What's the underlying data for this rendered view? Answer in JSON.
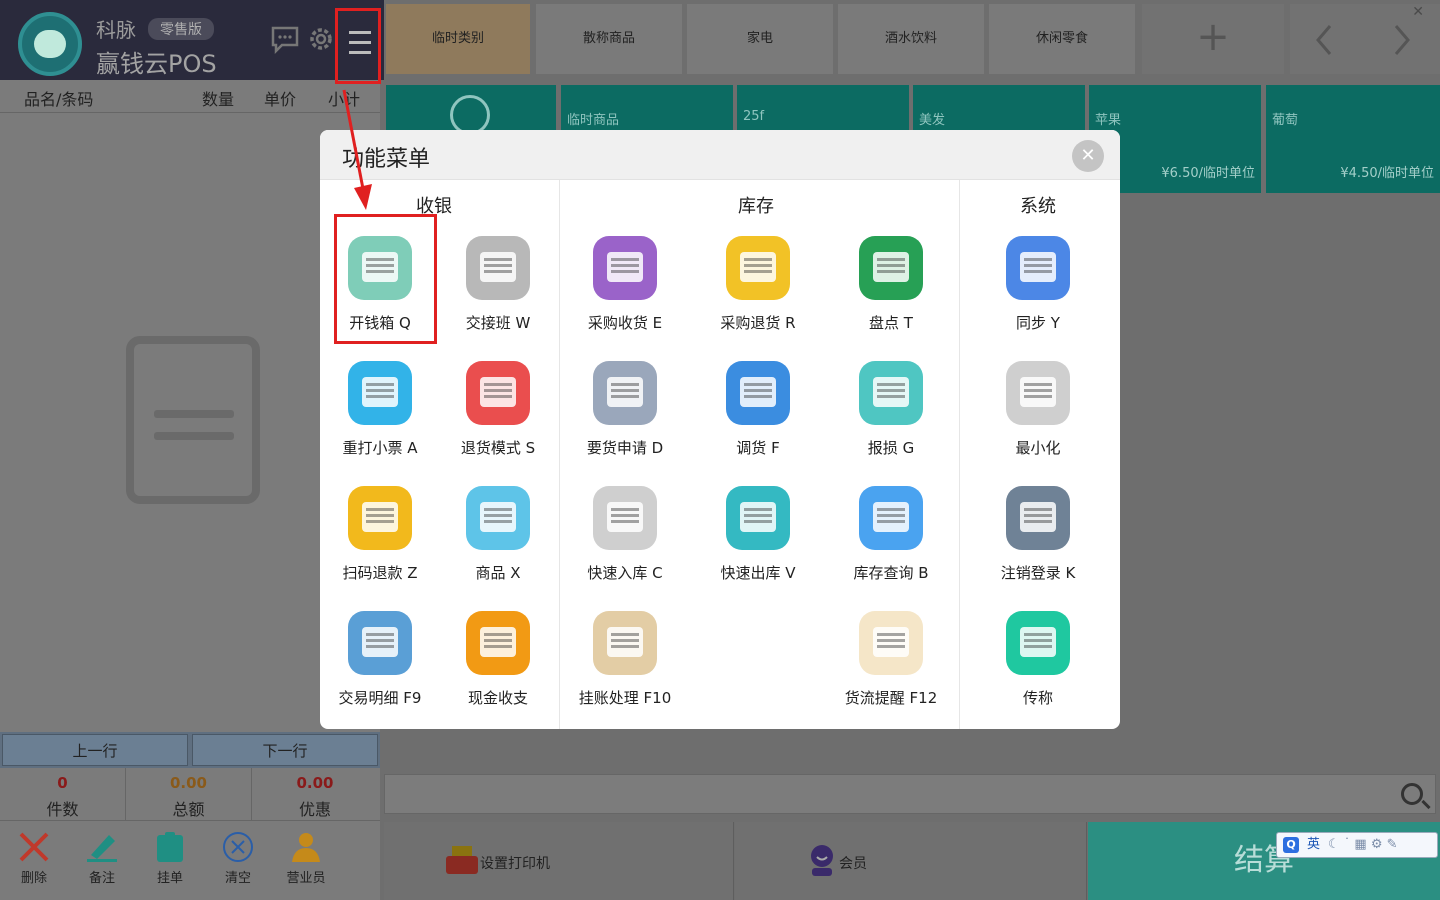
{
  "brand": {
    "company": "科脉",
    "edition": "零售版",
    "product": "赢钱云POS"
  },
  "columns": {
    "name": "品名/条码",
    "qty": "数量",
    "price": "单价",
    "subtotal": "小计"
  },
  "nav": {
    "prev": "上一行",
    "next": "下一行"
  },
  "stats": [
    {
      "value": "0",
      "label": "件数"
    },
    {
      "value": "0.00",
      "label": "总额"
    },
    {
      "value": "0.00",
      "label": "优惠"
    }
  ],
  "tools": [
    {
      "label": "删除",
      "icon": "delete-icon",
      "color": "#c0392b"
    },
    {
      "label": "备注",
      "icon": "note-icon",
      "color": "#1f8f83"
    },
    {
      "label": "挂单",
      "icon": "hold-order-icon",
      "color": "#1f8f83"
    },
    {
      "label": "清空",
      "icon": "clear-icon",
      "color": "#2a5ea8"
    },
    {
      "label": "营业员",
      "icon": "salesperson-icon",
      "color": "#c58a1a"
    }
  ],
  "categories": [
    "临时类别",
    "散称商品",
    "家电",
    "酒水饮料",
    "休闲零食"
  ],
  "products": [
    {
      "name": "",
      "price": ""
    },
    {
      "name": "临时商品",
      "price": ""
    },
    {
      "name": "25f",
      "price": ""
    },
    {
      "name": "美发",
      "price": ""
    },
    {
      "name": "苹果",
      "price": "¥6.50/临时单位"
    },
    {
      "name": "葡萄",
      "price": "¥4.50/临时单位"
    }
  ],
  "bottom": {
    "printer": "设置打印机",
    "member": "会员",
    "checkout": "结算"
  },
  "ime": {
    "lang": "英",
    "logo": "Q"
  },
  "modal": {
    "title": "功能菜单",
    "sections": {
      "cashier": "收银",
      "inventory": "库存",
      "system": "系统"
    },
    "items": [
      {
        "label": "开钱箱 Q",
        "icon": "cash-drawer-icon",
        "color": "#7fcdb8"
      },
      {
        "label": "交接班 W",
        "icon": "shift-handover-icon",
        "color": "#b8b8b8"
      },
      {
        "label": "采购收货 E",
        "icon": "purchase-receive-icon",
        "color": "#9a63c9"
      },
      {
        "label": "采购退货 R",
        "icon": "purchase-return-icon",
        "color": "#f2c226"
      },
      {
        "label": "盘点 T",
        "icon": "stocktake-icon",
        "color": "#27a055"
      },
      {
        "label": "同步 Y",
        "icon": "sync-cloud-icon",
        "color": "#4c87e6"
      },
      {
        "label": "重打小票 A",
        "icon": "reprint-receipt-icon",
        "color": "#32b3e8"
      },
      {
        "label": "退货模式 S",
        "icon": "return-mode-icon",
        "color": "#ea4e4e"
      },
      {
        "label": "要货申请 D",
        "icon": "request-goods-icon",
        "color": "#9aa7bb"
      },
      {
        "label": "调货 F",
        "icon": "transfer-icon",
        "color": "#3b8de0"
      },
      {
        "label": "报损 G",
        "icon": "damage-report-icon",
        "color": "#4fc6c2"
      },
      {
        "label": "最小化",
        "icon": "minimize-icon",
        "color": "#cfcfcf"
      },
      {
        "label": "扫码退款 Z",
        "icon": "scan-refund-icon",
        "color": "#f2b91c"
      },
      {
        "label": "商品 X",
        "icon": "goods-basket-icon",
        "color": "#5ec4e8"
      },
      {
        "label": "快速入库 C",
        "icon": "quick-stock-in-icon",
        "color": "#cfcfcf"
      },
      {
        "label": "快速出库 V",
        "icon": "quick-stock-out-icon",
        "color": "#34b9c2"
      },
      {
        "label": "库存查询 B",
        "icon": "stock-search-icon",
        "color": "#4aa3f0"
      },
      {
        "label": "注销登录 K",
        "icon": "logout-power-icon",
        "color": "#6f8296"
      },
      {
        "label": "交易明细 F9",
        "icon": "transaction-detail-icon",
        "color": "#5a9fd6"
      },
      {
        "label": "现金收支",
        "icon": "cash-flow-icon",
        "color": "#f29a14"
      },
      {
        "label": "挂账处理 F10",
        "icon": "credit-account-icon",
        "color": "#e3cda5"
      },
      {
        "label": "货流提醒 F12",
        "icon": "logistics-reminder-icon",
        "color": "#f5e6c8"
      },
      {
        "label": "传称",
        "icon": "scale-transfer-icon",
        "color": "#1fc8a0"
      }
    ]
  }
}
